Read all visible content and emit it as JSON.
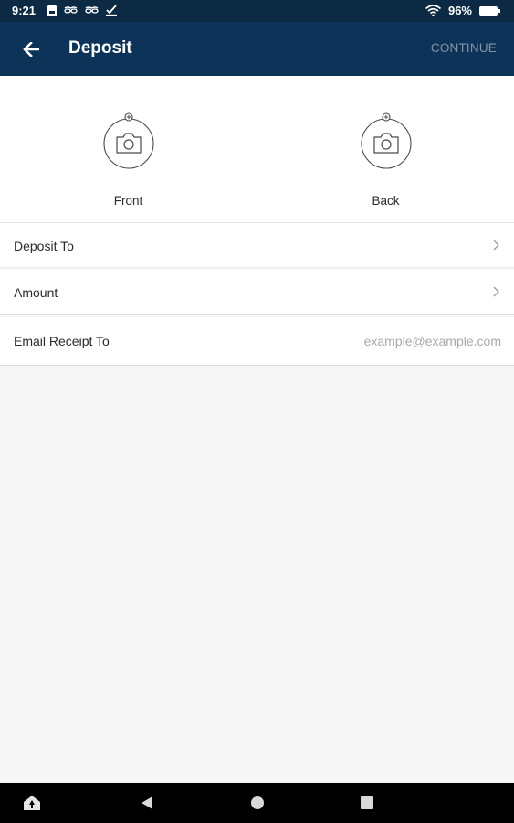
{
  "status_bar": {
    "time": "9:21",
    "battery_percent": "96%",
    "left_icons": [
      "sd-card-icon",
      "glasses-icon",
      "glasses-icon",
      "check-icon"
    ],
    "right_icons": [
      "wifi-icon",
      "battery-icon"
    ]
  },
  "app_bar": {
    "title": "Deposit",
    "continue_label": "CONTINUE",
    "back_icon": "arrow-back-icon"
  },
  "check_capture": {
    "front_label": "Front",
    "back_label": "Back",
    "icon": "camera-icon"
  },
  "form": {
    "deposit_to_label": "Deposit To",
    "amount_label": "Amount",
    "email_label": "Email Receipt To",
    "email_placeholder": "example@example.com",
    "email_value": ""
  },
  "nav_bar": {
    "buttons": [
      "home-icon",
      "back-triangle-icon",
      "home-circle-icon",
      "recents-square-icon"
    ]
  },
  "colors": {
    "app_bar": "#0d3358",
    "status_bar": "#0d2a45",
    "background": "#f6f6f6",
    "continue_text": "#8194a8",
    "placeholder_text": "#a9a9a9"
  }
}
